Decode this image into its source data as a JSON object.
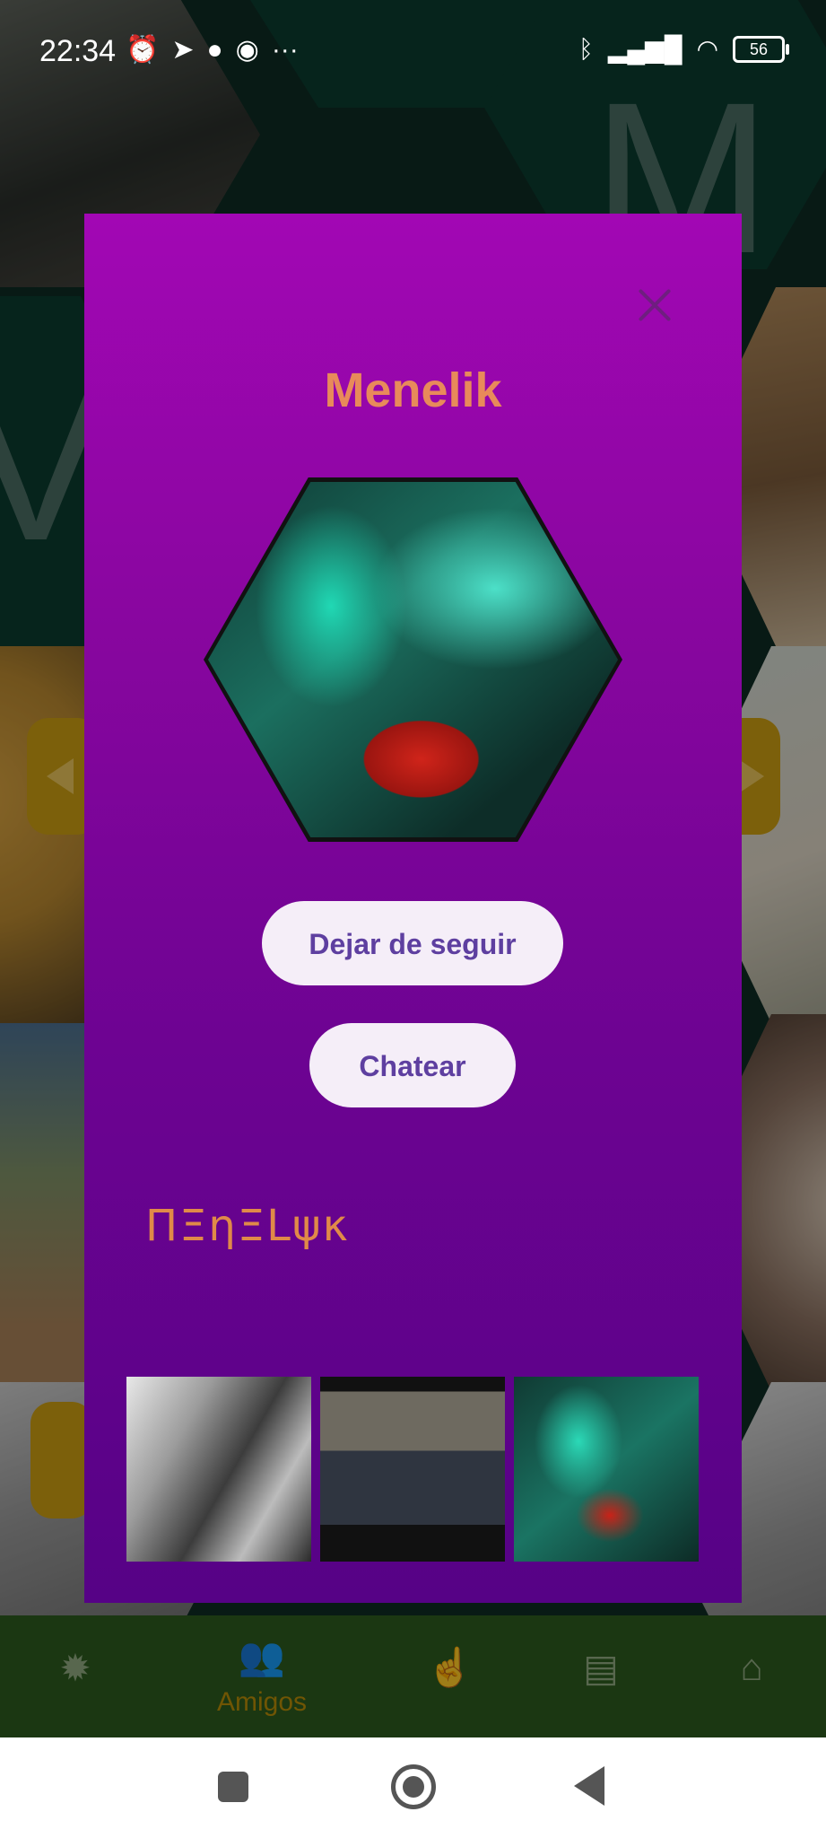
{
  "status_bar": {
    "time": "22:34",
    "battery": "56",
    "left_icons": [
      "alarm-icon",
      "telegram-icon",
      "chat-bubble-icon",
      "messenger-icon",
      "more-dots-icon"
    ],
    "right_icons": [
      "bluetooth-icon",
      "signal-icon",
      "wifi-icon",
      "battery-icon"
    ]
  },
  "background": {
    "hex_letters": [
      "M",
      "V"
    ]
  },
  "modal": {
    "title": "Menelik",
    "unfollow_label": "Dejar de seguir",
    "chat_label": "Chatear",
    "signature": "ΠΞηΞLψκ",
    "title_color": "#e88a5a",
    "gradient_top": "#a207b4",
    "gradient_bottom": "#560286"
  },
  "bottom_nav": {
    "items": [
      {
        "icon": "bug-icon",
        "label": ""
      },
      {
        "icon": "people-icon",
        "label": "Amigos",
        "active": true
      },
      {
        "icon": "touch-rotate-icon",
        "label": ""
      },
      {
        "icon": "message-icon",
        "label": ""
      },
      {
        "icon": "home-icon",
        "label": ""
      }
    ],
    "active_color": "#b58a08"
  }
}
